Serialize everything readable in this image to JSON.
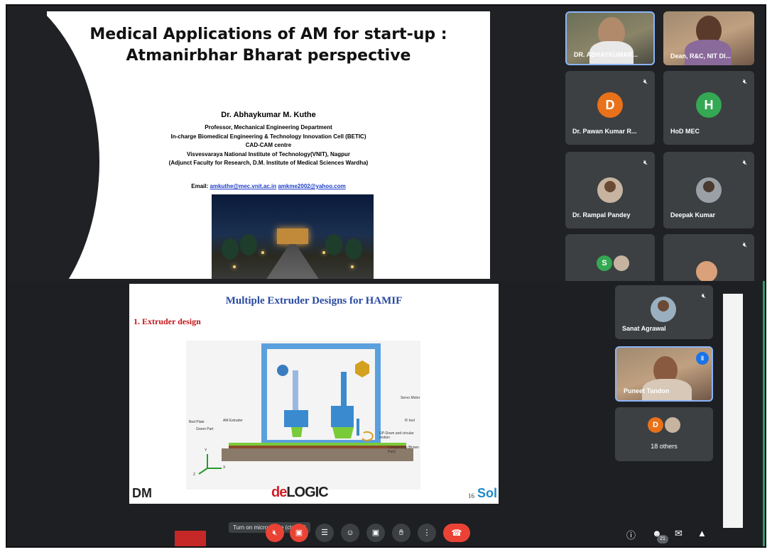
{
  "top_slide": {
    "title_line1": "Medical Applications of AM for start-up :",
    "title_line2": "Atmanirbhar Bharat perspective",
    "author": "Dr. Abhaykumar M. Kuthe",
    "lines": [
      "Professor, Mechanical Engineering Department",
      "In-charge Biomedical Engineering & Technology Innovation Cell (BETIC)",
      "CAD-CAM centre",
      "Visvesvaraya National Institute of Technology(VNIT), Nagpur",
      "(Adjunct Faculty for Research, D.M. Institute of Medical Sciences Wardha)"
    ],
    "email_label": "Email:",
    "email1": "amkuthe@mec.vnit.ac.in",
    "email2": "amkme2002@yahoo.com"
  },
  "top_participants": [
    {
      "name": "DR. ABHAYKUMAR..."
    },
    {
      "name": "Dean, R&C, NIT Dl..."
    },
    {
      "name": "Dr. Pawan Kumar R...",
      "initial": "D",
      "color": "#e8711a"
    },
    {
      "name": "HoD MEC",
      "initial": "H",
      "color": "#34a853"
    },
    {
      "name": "Dr. Rampal Pandey"
    },
    {
      "name": "Deepak Kumar"
    },
    {
      "initial": "S",
      "color": "#34a853"
    }
  ],
  "bottom_slide": {
    "title": "Multiple Extruder Designs for HAMIF",
    "subtitle": "1. Extruder design",
    "labels": {
      "servo": "Servo Motor",
      "if_tool": "IF tool",
      "am_extruder": "AM Extruder",
      "bed_plate": "Bed Plate",
      "green_part": "Green Part",
      "updown": "UP-Down and circular motion",
      "compacting": "Compacting (Brown Part)",
      "axis_x": "X",
      "axis_y": "Y",
      "axis_z": "Z"
    },
    "brand_left": "DM",
    "brand_de": "de",
    "brand_logic": "LOGIC",
    "page": "16",
    "brand_right": "Sol"
  },
  "bottom_participants": [
    {
      "name": "Sanat Agrawal"
    },
    {
      "name": "Puneet Tandon"
    },
    {
      "name": "18 others",
      "initial": "D",
      "color": "#e8711a"
    }
  ],
  "controls": {
    "tooltip": "Turn on microphone (ctrl + d)",
    "people_count": "21"
  }
}
